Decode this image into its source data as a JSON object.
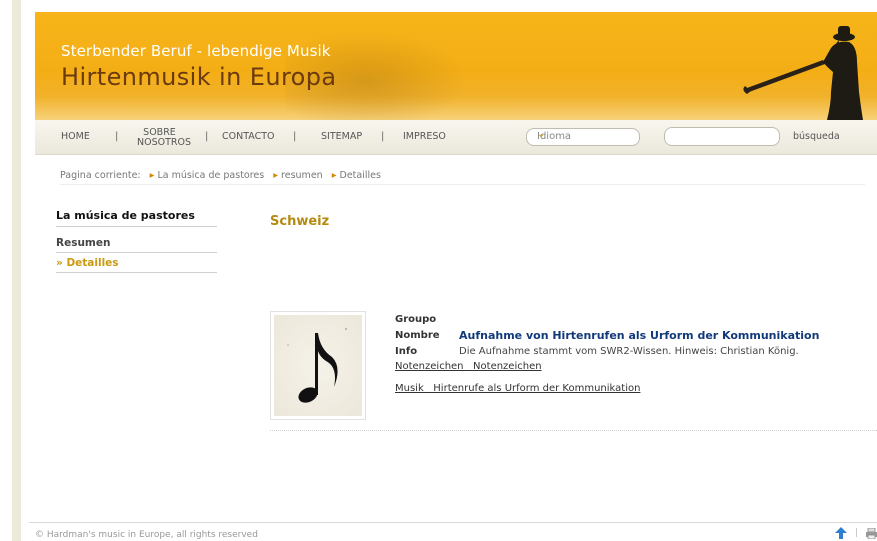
{
  "header": {
    "tagline": "Sterbender Beruf - lebendige Musik",
    "title": "Hirtenmusik in Europa"
  },
  "nav": {
    "items": [
      {
        "label": "HOME"
      },
      {
        "label": "SOBRE NOSOTROS",
        "line1": "SOBRE",
        "line2": "NOSOTROS"
      },
      {
        "label": "CONTACTO"
      },
      {
        "label": "SITEMAP"
      },
      {
        "label": "IMPRESO"
      }
    ],
    "separator": "|",
    "language_select": {
      "value": "Idioma"
    },
    "search": {
      "value": "",
      "button": "búsqueda"
    }
  },
  "breadcrumb": {
    "prefix": "Pagina corriente:",
    "items": [
      "La música de pastores",
      "resumen",
      "Detailles"
    ]
  },
  "sidebar": {
    "title": "La música de pastores",
    "items": [
      {
        "label": "Resumen",
        "active": false
      },
      {
        "label": "» Detailles",
        "active": true
      }
    ]
  },
  "main": {
    "title": "Schweiz",
    "entry": {
      "labels": {
        "group": "Groupo",
        "name": "Nombre",
        "info": "Info"
      },
      "name": "Aufnahme von Hirtenrufen als Urform der Kommunikation",
      "info": "Die Aufnahme stammt vom SWR2-Wissen. Hinweis: Christian König.",
      "link1": "Notenzeichen   Notenzeichen",
      "link2": "Musik   Hirtenrufe als Urform der Kommunikation",
      "thumbnail_icon": "eighth-note"
    }
  },
  "footer": {
    "text": "© Hardman's music in Europe, all rights reserved",
    "separator": "|"
  },
  "colors": {
    "header": "#f4ae15",
    "title_brown": "#6b3a0e",
    "accent_gold": "#b48a10",
    "link_blue": "#123a7a"
  }
}
